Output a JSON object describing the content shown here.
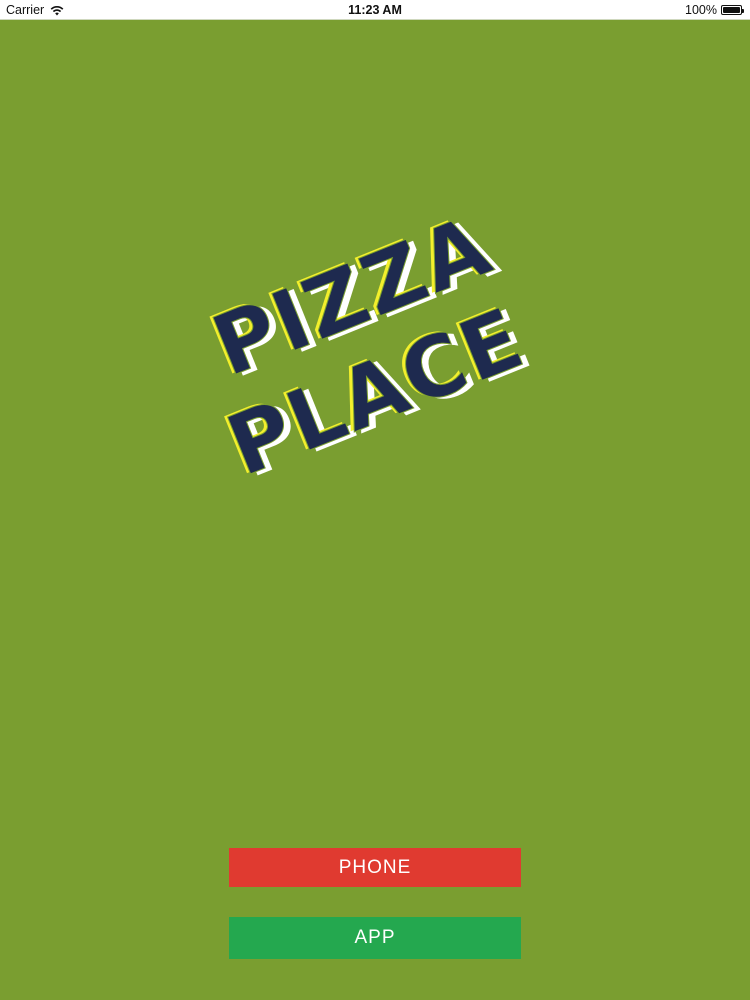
{
  "status_bar": {
    "carrier": "Carrier",
    "time": "11:23 AM",
    "battery_percent": "100%",
    "icons": [
      "wifi-icon",
      "battery-icon"
    ]
  },
  "logo": {
    "line1": "PIZZA",
    "line2": "PLACE",
    "colors": {
      "fill": "#1e2a4f",
      "highlight": "#f3ef2c",
      "shadow": "#ffffff"
    }
  },
  "buttons": {
    "phone_label": "PHONE",
    "app_label": "APP"
  },
  "colors": {
    "background": "#7a9e30",
    "phone_button": "#e03a30",
    "app_button": "#24a84f"
  }
}
